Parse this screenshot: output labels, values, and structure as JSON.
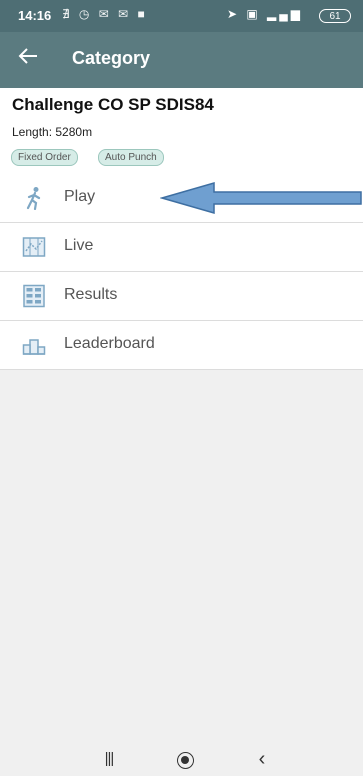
{
  "status_bar": {
    "time": "14:16",
    "left_icons": "∄ ◷ ✉ ✉ ■",
    "right_icons": "➤ ▣ ▂▄▆",
    "battery": "61"
  },
  "app_bar": {
    "back_icon": "arrow-left-icon",
    "title": "Category"
  },
  "category": {
    "name": "Challenge CO SP SDIS84",
    "length": "Length: 5280m",
    "tags": [
      "Fixed Order",
      "Auto Punch"
    ]
  },
  "menu": {
    "items": [
      {
        "label": "Play",
        "icon": "walker-icon"
      },
      {
        "label": "Live",
        "icon": "map-icon"
      },
      {
        "label": "Results",
        "icon": "results-grid-icon"
      },
      {
        "label": "Leaderboard",
        "icon": "podium-icon"
      }
    ]
  },
  "nav": {
    "recents": "|||",
    "home": "home-icon",
    "back": "‹"
  },
  "colors": {
    "status_bar": "#4e6e74",
    "app_bar": "#5b7b80",
    "chip": "#d6ece7",
    "arrow": "#6f9fd0",
    "icon": "#7ea7c4"
  }
}
